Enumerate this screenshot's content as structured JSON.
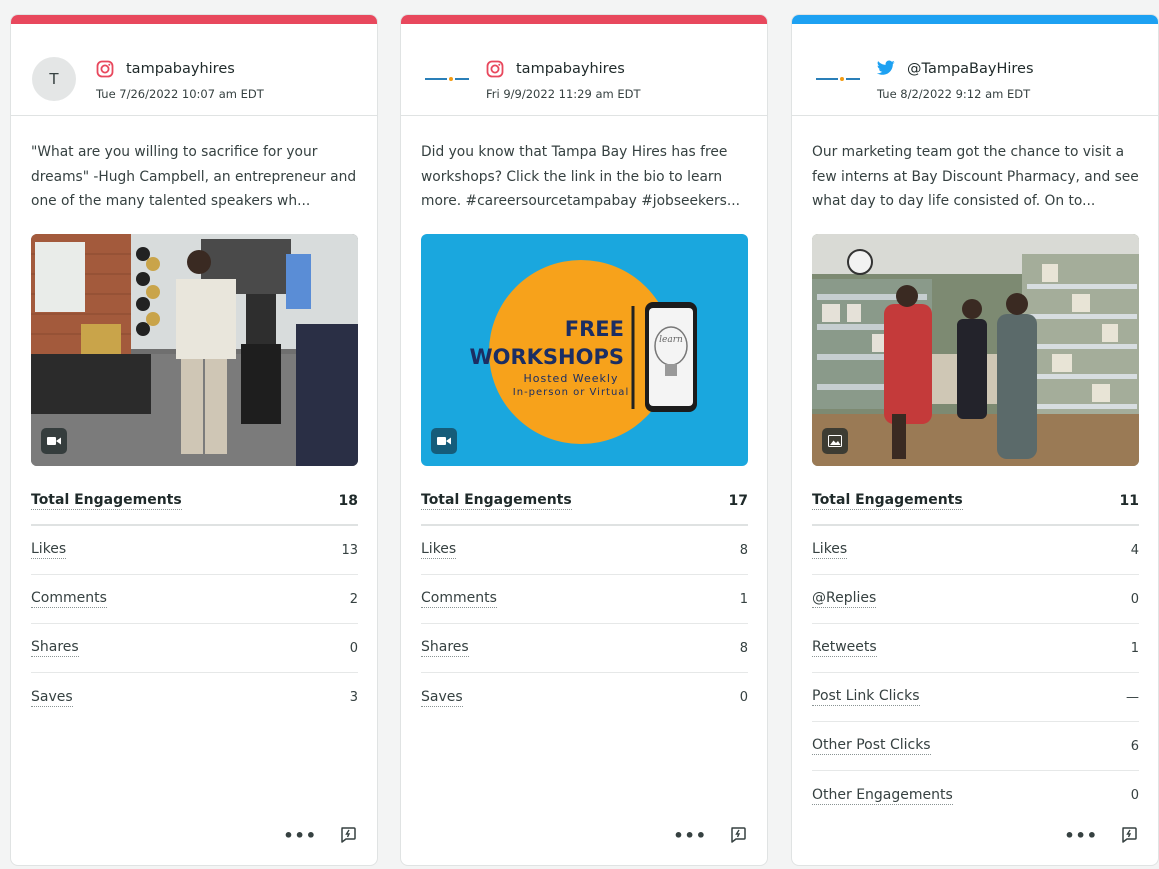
{
  "colors": {
    "instagram_bar": "#e8485d",
    "twitter_bar": "#1da1f2",
    "twitter_icon": "#1da1f2",
    "instagram_icon": "#e8485d"
  },
  "cards": [
    {
      "network_icon": "instagram-icon",
      "avatar_letter": "T",
      "account": "tampabayhires",
      "timestamp": "Tue 7/26/2022 10:07 am EDT",
      "text": "\"What are you willing to sacrifice for your dreams\" -Hugh Campbell, an entrepreneur and one of the many talented speakers wh...",
      "media_type_icon": "video-icon",
      "metrics": [
        {
          "label": "Total Engagements",
          "value": "18"
        },
        {
          "label": "Likes",
          "value": "13"
        },
        {
          "label": "Comments",
          "value": "2"
        },
        {
          "label": "Shares",
          "value": "0"
        },
        {
          "label": "Saves",
          "value": "3"
        }
      ]
    },
    {
      "network_icon": "instagram-icon",
      "account": "tampabayhires",
      "timestamp": "Fri 9/9/2022 11:29 am EDT",
      "text": "Did you know that Tampa Bay Hires has free workshops? Click the link in the bio to learn more. #careersourcetampabay #jobseekers...",
      "media_type_icon": "video-icon",
      "media_text": {
        "title1": "FREE",
        "title2": "WORKSHOPS",
        "sub1": "Hosted Weekly",
        "sub2": "In-person or Virtual",
        "phone_word": "learn"
      },
      "metrics": [
        {
          "label": "Total Engagements",
          "value": "17"
        },
        {
          "label": "Likes",
          "value": "8"
        },
        {
          "label": "Comments",
          "value": "1"
        },
        {
          "label": "Shares",
          "value": "8"
        },
        {
          "label": "Saves",
          "value": "0"
        }
      ]
    },
    {
      "network_icon": "twitter-icon",
      "account": "@TampaBayHires",
      "timestamp": "Tue 8/2/2022 9:12 am EDT",
      "text": "Our marketing team got the chance to visit a few interns at Bay Discount Pharmacy, and see what day to day life consisted of. On to...",
      "media_type_icon": "image-icon",
      "metrics": [
        {
          "label": "Total Engagements",
          "value": "11"
        },
        {
          "label": "Likes",
          "value": "4"
        },
        {
          "label": "@Replies",
          "value": "0"
        },
        {
          "label": "Retweets",
          "value": "1"
        },
        {
          "label": "Post Link Clicks",
          "value": "—"
        },
        {
          "label": "Other Post Clicks",
          "value": "6"
        },
        {
          "label": "Other Engagements",
          "value": "0"
        }
      ]
    }
  ]
}
